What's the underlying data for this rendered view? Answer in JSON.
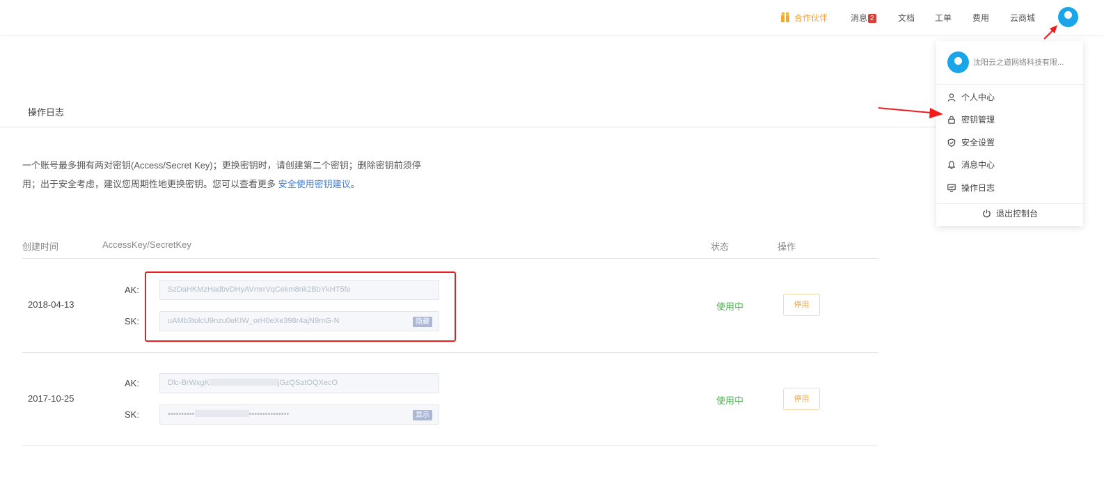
{
  "topbar": {
    "partner": "合作伙伴",
    "messages": "消息",
    "messages_badge": "2",
    "docs": "文档",
    "ticket": "工单",
    "fees": "费用",
    "market": "云商城"
  },
  "tabs": {
    "operation_log": "操作日志"
  },
  "notice": {
    "line1": "一个账号最多拥有两对密钥(Access/Secret Key)；更换密钥时，请创建第二个密钥；删除密钥前须停",
    "line2_prefix": "用；出于安全考虑，建议您周期性地更换密钥。您可以查看更多 ",
    "link": "安全使用密钥建议",
    "line2_suffix": "。"
  },
  "table": {
    "headers": {
      "created": "创建时间",
      "keys": "AccessKey/SecretKey",
      "status": "状态",
      "action": "操作"
    },
    "ak_label": "AK:",
    "sk_label": "SK:",
    "rows": [
      {
        "date": "2018-04-13",
        "ak": "SzDaHKMzHadbvDHyAVmrrVqCekm8nk2BbYkHT5fe",
        "sk": "uAMb3tolcU9nzu0eKIW_orH0eXe398r4ajN9mG-N",
        "sk_button": "隐藏",
        "status": "使用中",
        "action": "停用"
      },
      {
        "date": "2017-10-25",
        "ak_start": "Dlc-BrWxgK",
        "ak_end": "jGzQSatOQXecO",
        "sk_masked_start": "••••••••••",
        "sk_masked_end": "•••••••••••••••",
        "sk_button": "显示",
        "status": "使用中",
        "action": "停用"
      }
    ]
  },
  "dropdown": {
    "company": "沈阳云之道网络科技有限...",
    "items": [
      {
        "label": "个人中心",
        "icon": "user-icon"
      },
      {
        "label": "密钥管理",
        "icon": "lock-icon"
      },
      {
        "label": "安全设置",
        "icon": "shield-icon"
      },
      {
        "label": "消息中心",
        "icon": "bell-icon"
      },
      {
        "label": "操作日志",
        "icon": "log-icon"
      }
    ],
    "logout": "退出控制台"
  },
  "colors": {
    "accent_orange": "#f2a74a",
    "status_green": "#4caf50",
    "link_blue": "#3a7de0",
    "highlight_red": "#f01c1c",
    "avatar_blue": "#1aa5e8"
  }
}
